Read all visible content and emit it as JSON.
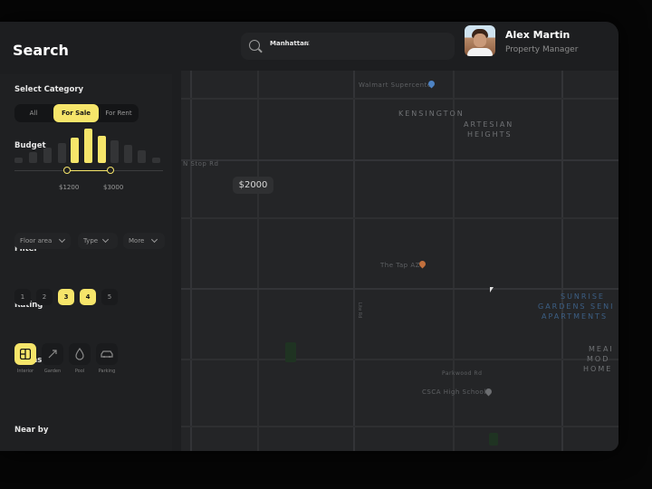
{
  "header": {
    "title": "Search",
    "search_chip": "Manhattan",
    "chip_close": "×"
  },
  "user": {
    "name": "Alex Martin",
    "role": "Property Manager"
  },
  "sidebar": {
    "category": {
      "label": "Select Category",
      "options": [
        "All",
        "For Sale",
        "For Rent"
      ],
      "selected": "For Sale"
    },
    "budget": {
      "label": "Budget",
      "min_label": "$1200",
      "max_label": "$3000"
    },
    "filter": {
      "label": "Filter",
      "dropdowns": [
        "Floor area",
        "Type",
        "More"
      ]
    },
    "rating": {
      "label": "Rating",
      "options": [
        "1",
        "2",
        "3",
        "4",
        "5"
      ],
      "selected": [
        "3",
        "4"
      ]
    },
    "extras": {
      "label": "Extras",
      "items": [
        "Interior",
        "Garden",
        "Pool",
        "Parking"
      ],
      "selected": "Interior"
    },
    "nearby": {
      "label": "Near by"
    }
  },
  "map": {
    "price_pin": "$2000",
    "places": {
      "walmart": "Walmart Supercenter",
      "kensington": "KENSINGTON",
      "artesian": "ARTESIAN",
      "heights": "HEIGHTS",
      "the_tap": "The Tap AZ",
      "sunrise_1": "SUNRISE",
      "sunrise_2": "GARDENS SENI",
      "sunrise_3": "APARTMENTS",
      "mead_1": "MEAI",
      "mead_2": "MOD",
      "mead_3": "HOME",
      "school": "CSCA High School",
      "park_rd": "Parkwood Rd",
      "lite_st": "Lite Rd",
      "street_left": "N Stop Rd"
    }
  },
  "colors": {
    "accent": "#f6e56a",
    "background": "#1d1e20",
    "map": "#242527"
  }
}
